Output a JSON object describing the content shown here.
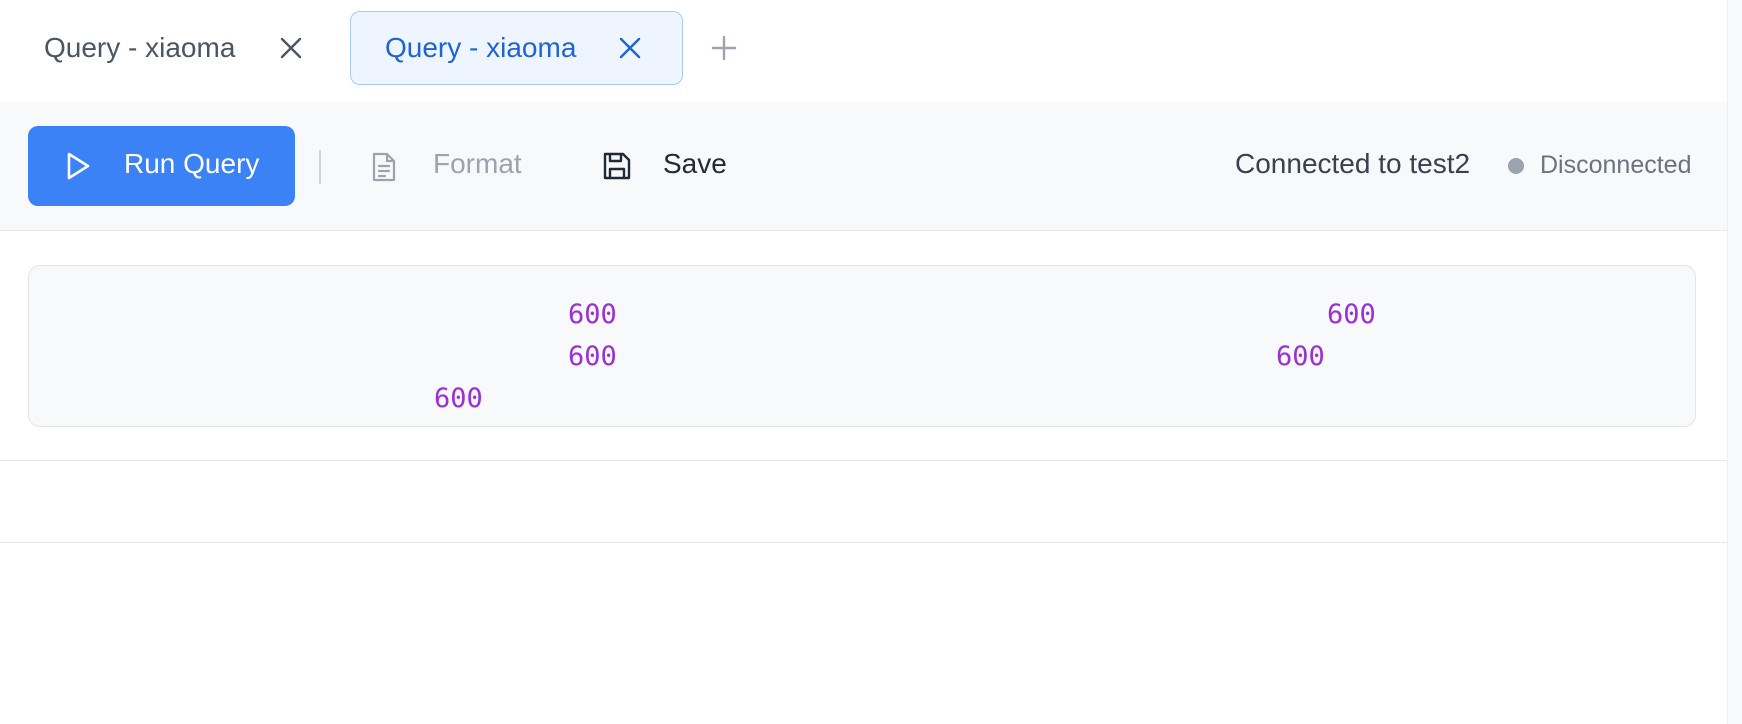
{
  "tabs": [
    {
      "label": "Query - xiaoma",
      "active": false
    },
    {
      "label": "Query - xiaoma",
      "active": true
    }
  ],
  "toolbar": {
    "run_label": "Run Query",
    "format_label": "Format",
    "save_label": "Save",
    "connection_text": "Connected to test2",
    "status_text": "Disconnected"
  },
  "editor": {
    "tokens": [
      "600",
      "600",
      "600",
      "600",
      "600"
    ]
  },
  "colors": {
    "accent": "#3b82f6",
    "active_tab_text": "#1f63d8",
    "token": "#9b30d9",
    "status_dot": "#9ca3af"
  },
  "icons": {
    "tab_close": "close-icon",
    "add_tab": "plus-icon",
    "run": "play-icon",
    "format": "document-icon",
    "save": "save-icon"
  }
}
